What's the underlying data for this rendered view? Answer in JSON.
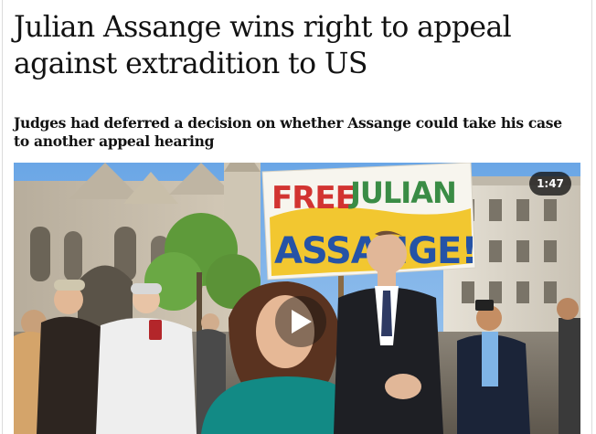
{
  "article": {
    "headline": "Julian Assange wins right to appeal against extradition to US",
    "standfirst": "Judges had deferred a decision on whether Assange could take his case to another appeal hearing"
  },
  "video": {
    "duration": "1:47",
    "play_icon": "play-icon",
    "placard": {
      "line1_a": "FREE",
      "line1_b": "JULIAN",
      "line2": "ASSANGE!"
    }
  },
  "colors": {
    "text": "#121212",
    "placard_blue": "#2553a6",
    "placard_red": "#d23431",
    "placard_green": "#3a8c45",
    "placard_yellow": "#f1c21b",
    "dress_teal": "#128a85"
  }
}
